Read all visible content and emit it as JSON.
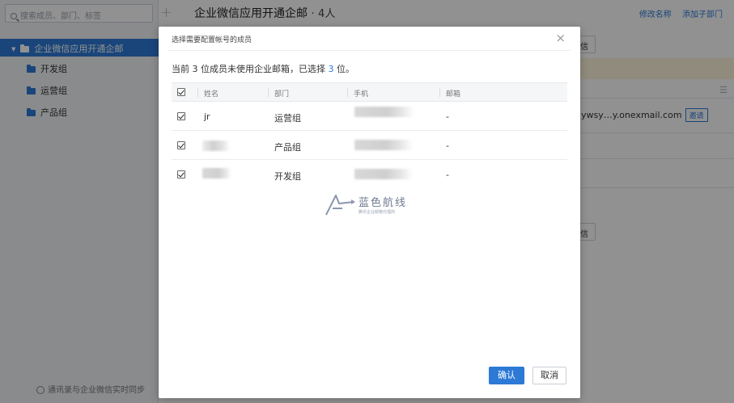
{
  "sidebar": {
    "search_placeholder": "搜索成员、部门、标签",
    "add_symbol": "+",
    "root_label": "企业微信应用开通企邮",
    "items": [
      {
        "label": "开发组"
      },
      {
        "label": "运营组"
      },
      {
        "label": "产品组"
      }
    ],
    "sync_text": "通讯录与企业微信实时同步"
  },
  "main": {
    "title": "企业微信应用开通企邮",
    "separator": "·",
    "count": "4人",
    "links": [
      "修改名称",
      "添加子部门"
    ],
    "row_email": "ywsy…y.onexmail.com",
    "invite_label": "邀请",
    "stub_label": "信"
  },
  "modal": {
    "title": "选择需要配置帐号的成员",
    "close_symbol": "×",
    "summary": {
      "prefix": "当前 ",
      "count": "3",
      "middle": " 位成员未使用企业邮箱，已选择 ",
      "selected": "3",
      "suffix": " 位。"
    },
    "columns": {
      "name": "姓名",
      "dept": "部门",
      "phone": "手机",
      "email": "邮箱"
    },
    "rows": [
      {
        "name": "jr",
        "dept": "运营组",
        "email": "-",
        "checked": true
      },
      {
        "name": "",
        "dept": "产品组",
        "email": "-",
        "checked": true
      },
      {
        "name": "",
        "dept": "开发组",
        "email": "-",
        "checked": true
      }
    ],
    "confirm_label": "确认",
    "cancel_label": "取消"
  },
  "watermark": {
    "text": "蓝色航线",
    "subtext": "腾讯企业邮箱代理商"
  },
  "colors": {
    "accent": "#2c79d6",
    "overlay": "rgba(0,0,0,0.43)",
    "notice_bg": "#fdf4dc"
  }
}
